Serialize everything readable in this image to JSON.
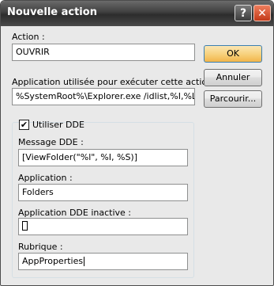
{
  "window": {
    "title": "Nouvelle action",
    "help_glyph": "?",
    "close_glyph": "✕"
  },
  "form": {
    "action": {
      "label": "Action :",
      "value": "OUVRIR"
    },
    "application": {
      "label": "Application utilisée pour exécuter cette action :",
      "value": "%SystemRoot%\\Explorer.exe /idlist,%I,%L"
    },
    "use_dde": {
      "label": "Utiliser DDE",
      "checked": true,
      "check_glyph": "✔"
    },
    "dde_message": {
      "label": "Message DDE :",
      "value": "[ViewFolder(\"%l\", %I, %S)]"
    },
    "dde_application": {
      "label": "Application :",
      "value": "Folders"
    },
    "dde_app_inactive": {
      "label": "Application DDE inactive :",
      "value": ""
    },
    "topic": {
      "label": "Rubrique :",
      "value": "AppProperties"
    }
  },
  "buttons": {
    "ok": "OK",
    "cancel": "Annuler",
    "browse": "Parcourir..."
  }
}
